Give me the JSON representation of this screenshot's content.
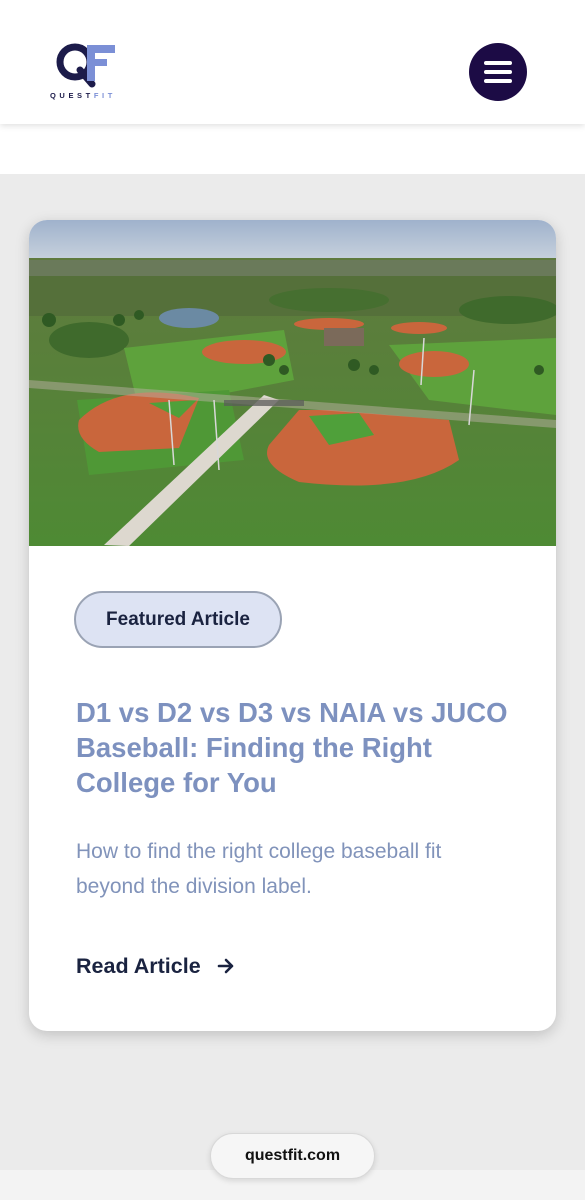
{
  "header": {
    "logo_word_part1": "QUEST",
    "logo_word_part2": "FIT",
    "menu_icon": "hamburger-icon",
    "brand_colors": {
      "navy": "#1c1b4a",
      "accent": "#7b8fd6",
      "menu_bg": "#1c0b45"
    }
  },
  "article": {
    "image_subject": "aerial-photo",
    "badge": "Featured Article",
    "title": "D1 vs D2 vs D3 vs NAIA vs JUCO Baseball: Finding the Right College for You",
    "summary": "How to find the right college baseball fit beyond the division label.",
    "read_link": "Read Article",
    "read_link_icon": "arrow-right-icon",
    "title_color": "#7d91bf"
  },
  "browser": {
    "url": "questfit.com"
  }
}
